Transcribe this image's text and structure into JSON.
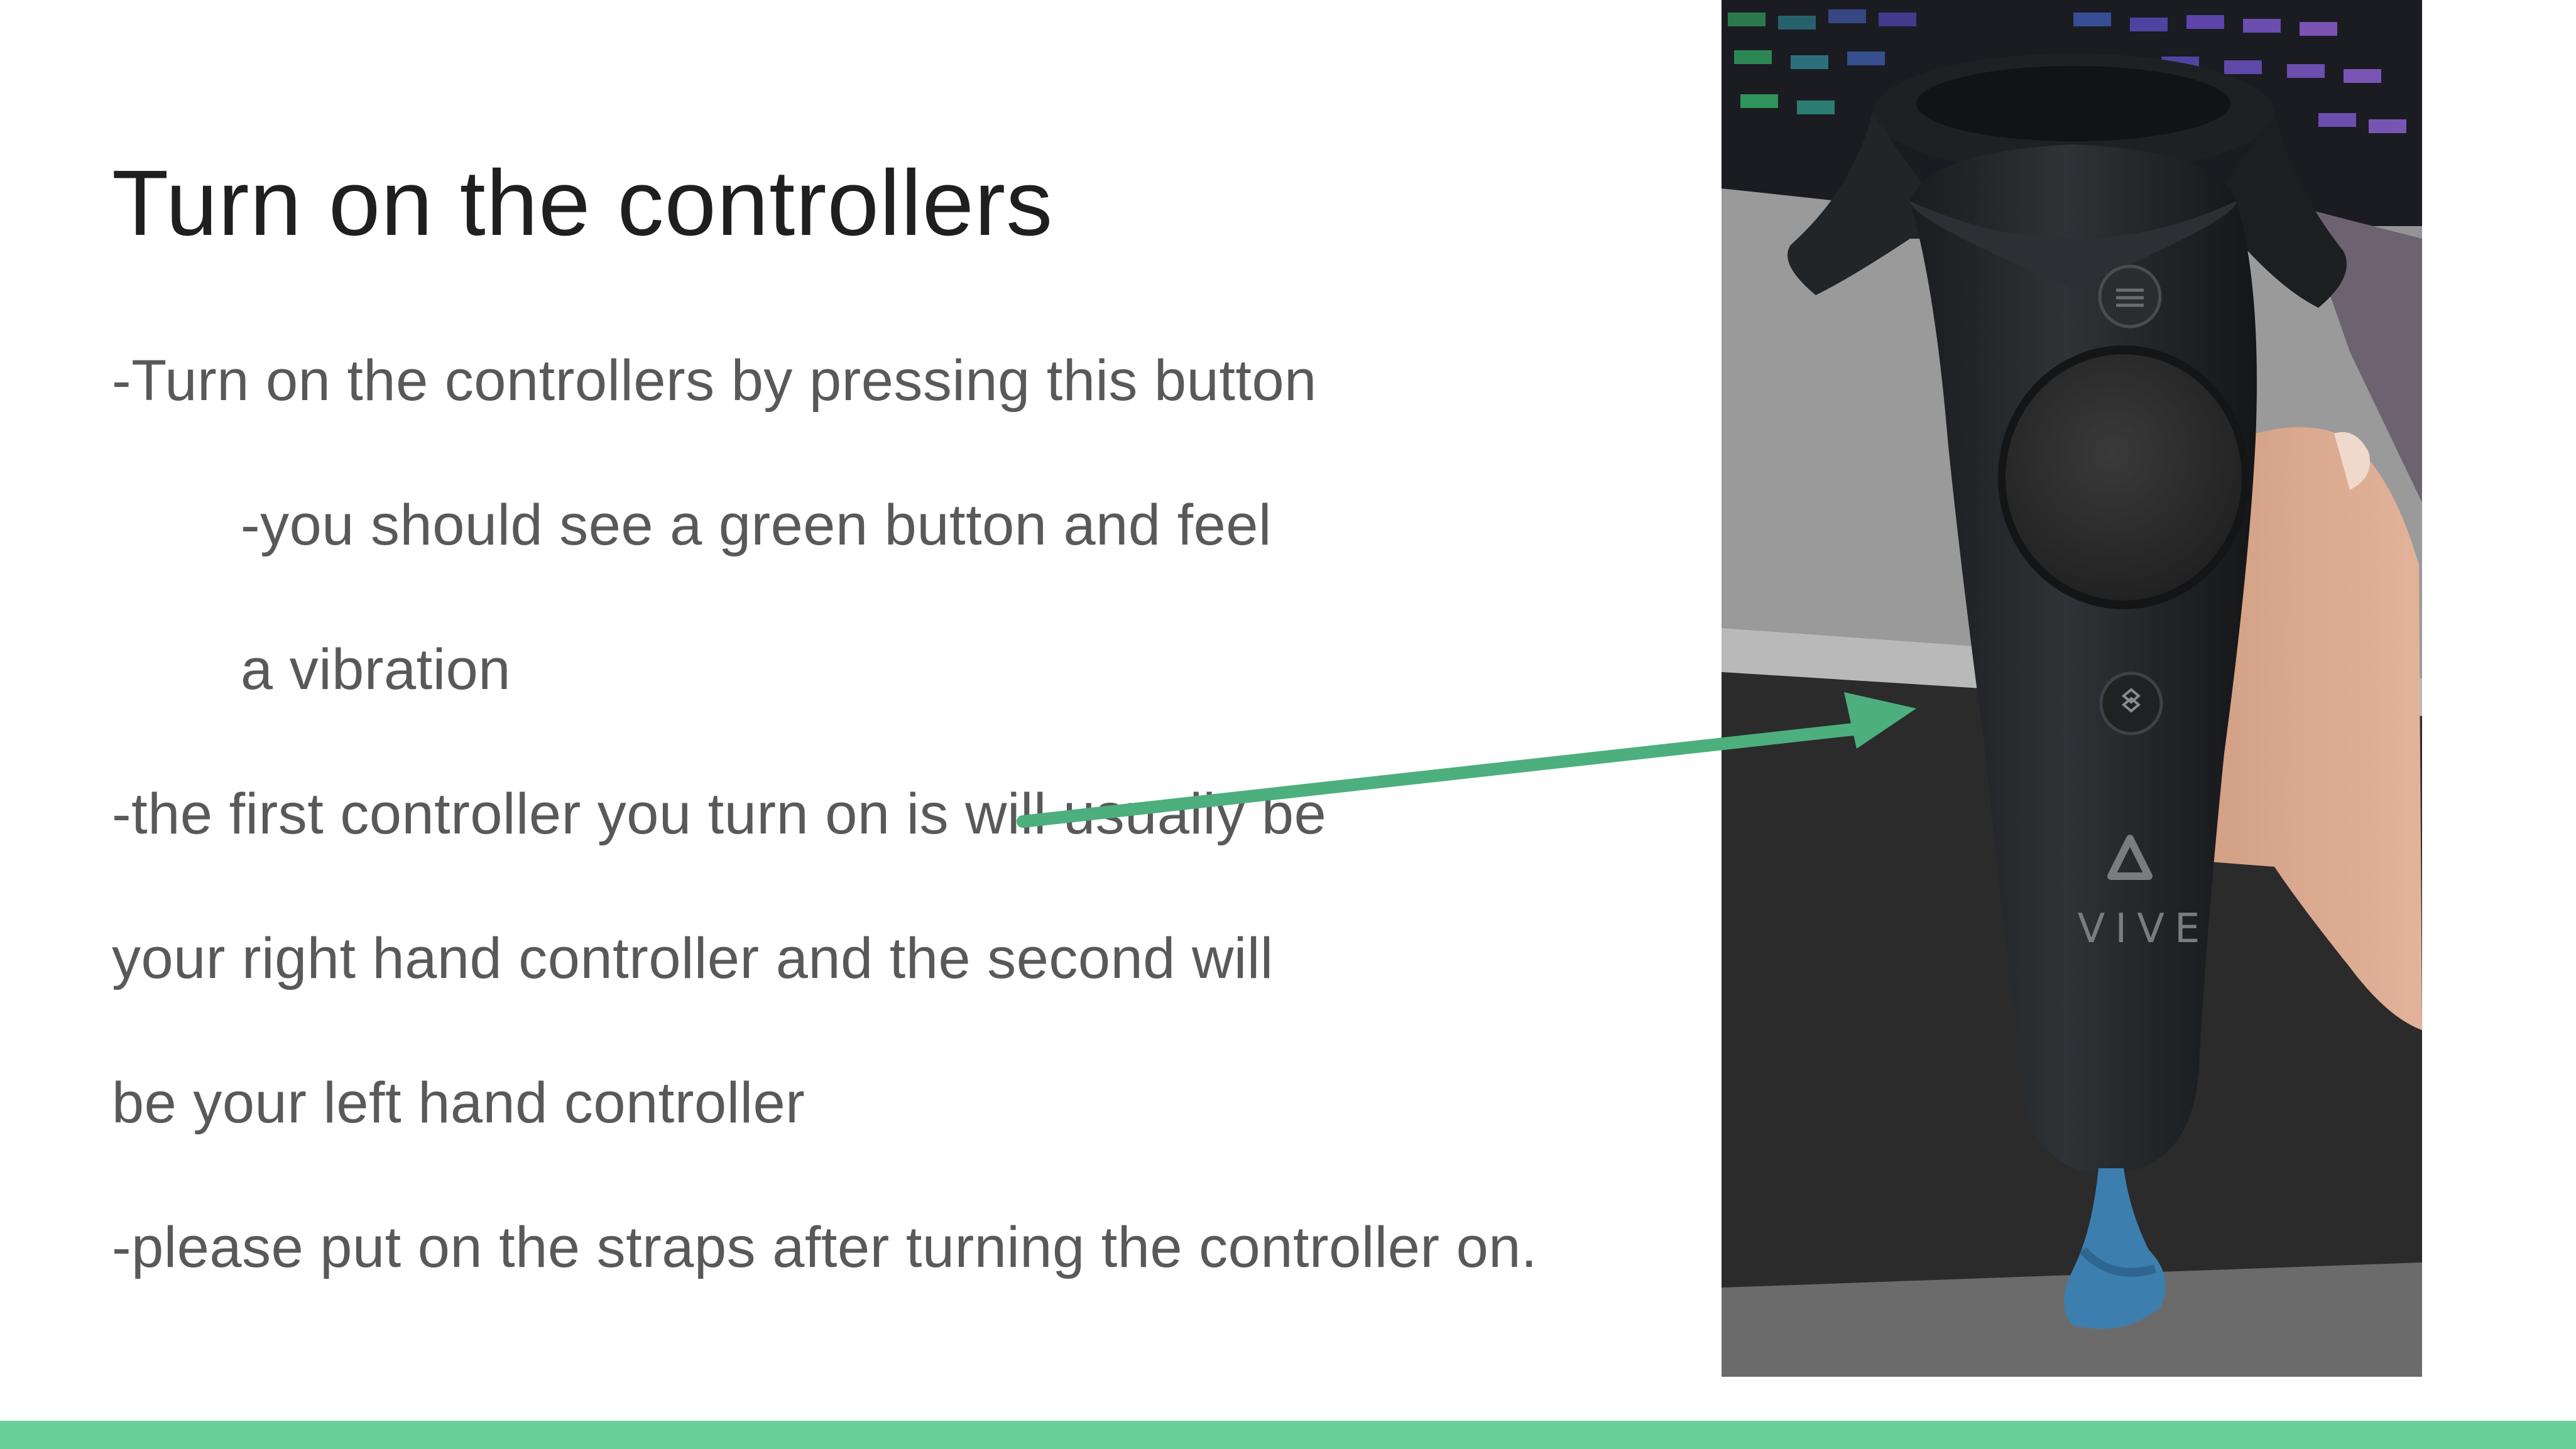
{
  "slide": {
    "title": "Turn on the controllers",
    "lines": [
      "-Turn on the controllers by pressing this button",
      "-you should see a green button and feel",
      "a vibration",
      "-the first controller you turn on is will usually be",
      "your right hand controller and the second will",
      "be your left hand controller",
      "-please put on the straps after turning the controller on."
    ],
    "photo": {
      "brand_mark": "VIVE",
      "icon": "vive-controller-icon"
    }
  },
  "colors": {
    "accent_bar": "#6ad09a",
    "arrow": "#4caf7d",
    "title_text": "#1f1f1f",
    "body_text": "#595959"
  }
}
